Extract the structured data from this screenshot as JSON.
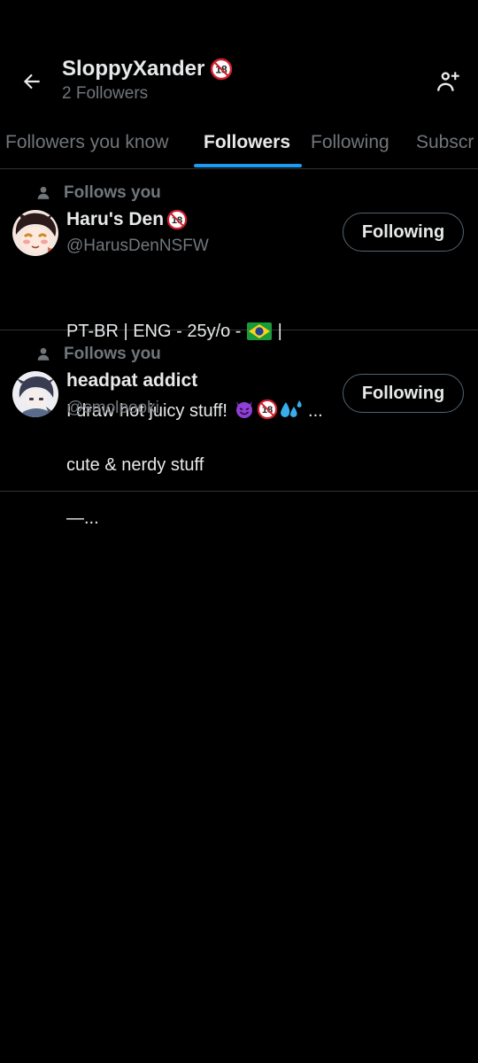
{
  "header": {
    "title": "SloppyXander",
    "title_badge": "18",
    "subtitle": "2 Followers",
    "back_icon": "arrow-left-icon",
    "add_icon": "person-add-icon"
  },
  "tabs": [
    {
      "label": "Followers you know",
      "active": false
    },
    {
      "label": "Followers",
      "active": true
    },
    {
      "label": "Following",
      "active": false
    },
    {
      "label": "Subscr",
      "active": false
    }
  ],
  "colors": {
    "background": "#000000",
    "accent": "#1d9bf0",
    "muted": "#71767b",
    "text": "#e7e9ea",
    "divider": "#2f3336"
  },
  "users": [
    {
      "follows_you": "Follows you",
      "name": "Haru's Den",
      "name_badge": "18",
      "handle": "@HarusDenNSFW",
      "bio_line1_a": "PT-BR | ENG - 25y/o - ",
      "bio_line1_b": " |",
      "bio_line2_a": "I draw hot juicy stuff! ",
      "bio_line2_b": " ...",
      "bio_emojis": [
        "brazil-flag-icon",
        "smiling-devil-icon",
        "no-one-under-18-icon",
        "sweat-droplets-icon"
      ],
      "button": "Following"
    },
    {
      "follows_you": "Follows you",
      "name": "headpat addict",
      "handle": "@smolpooki",
      "bio_line1_a": "cute & nerdy stuff",
      "bio_line2_a": "—...",
      "button": "Following"
    }
  ]
}
